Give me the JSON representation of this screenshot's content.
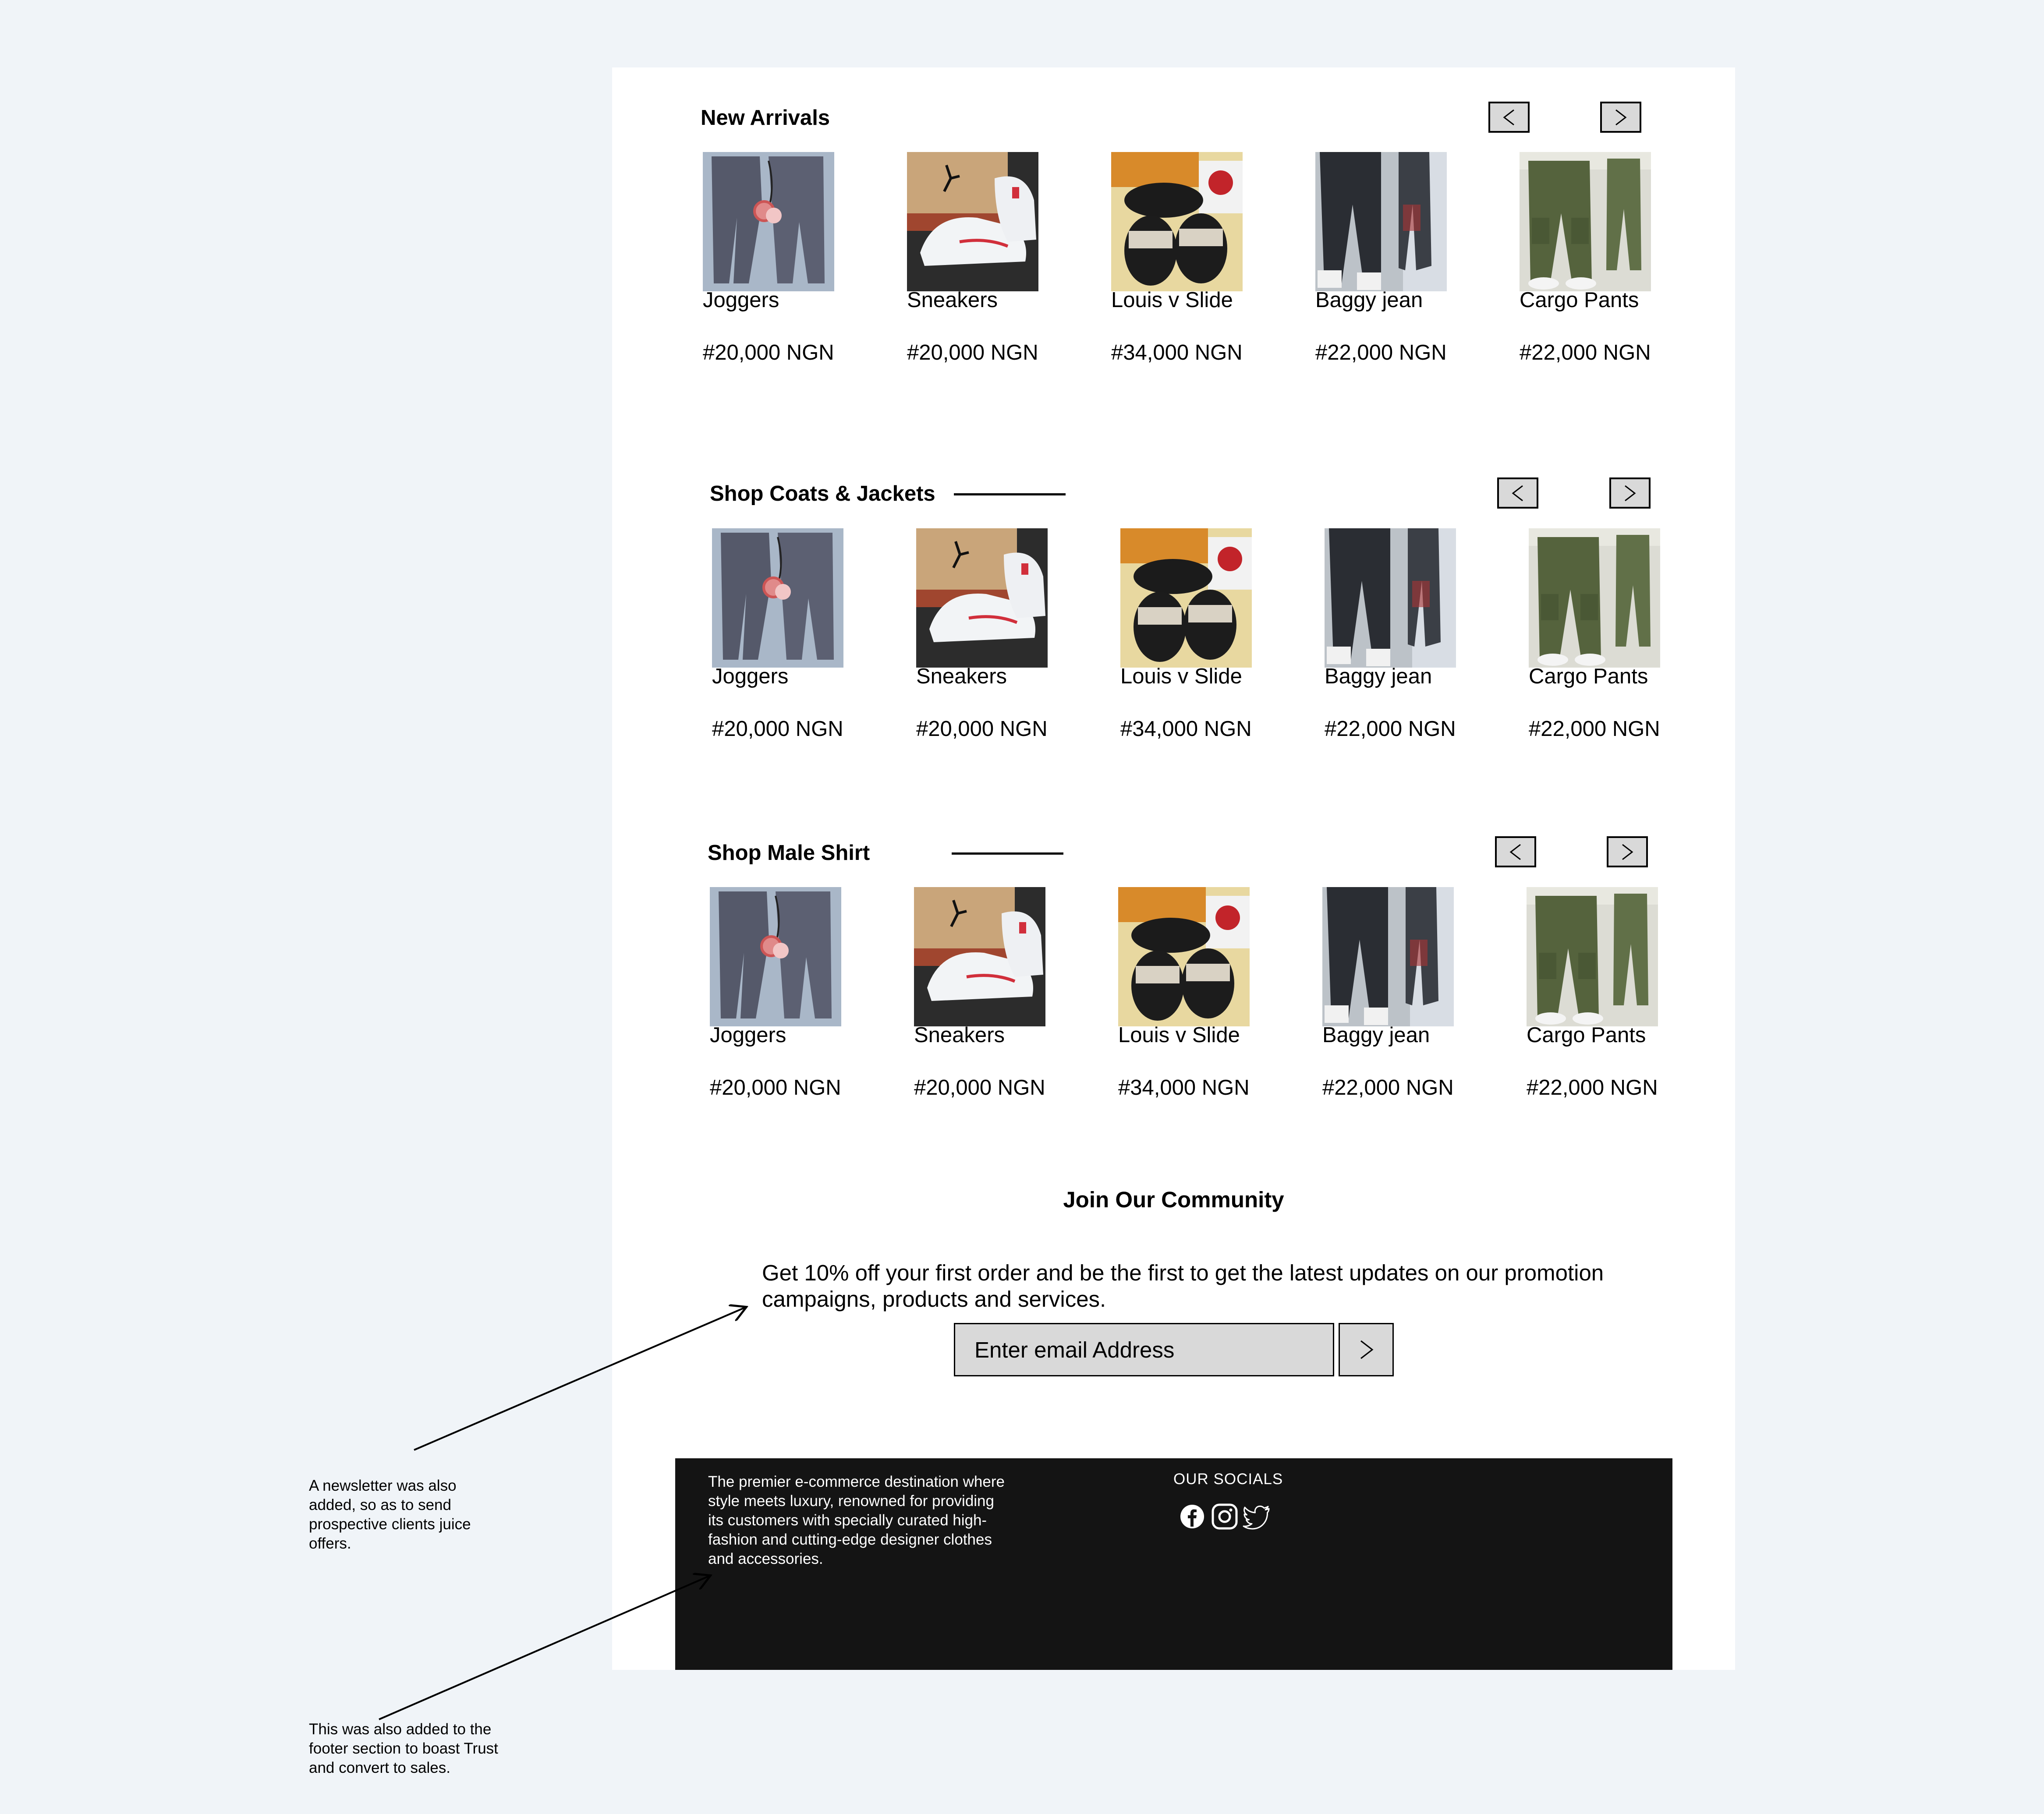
{
  "sections": [
    {
      "title": "New Arrivals",
      "prev_label": "<",
      "next_label": ">",
      "products": [
        {
          "name": "Joggers",
          "price": "#20,000 NGN",
          "image": "joggers"
        },
        {
          "name": "Sneakers",
          "price": "#20,000 NGN",
          "image": "sneakers"
        },
        {
          "name": "Louis v Slide",
          "price": "#34,000 NGN",
          "image": "slides"
        },
        {
          "name": "Baggy jean",
          "price": "#22,000 NGN",
          "image": "jeans"
        },
        {
          "name": "Cargo Pants",
          "price": "#22,000 NGN",
          "image": "cargo"
        }
      ]
    },
    {
      "title": "Shop Coats & Jackets",
      "prev_label": "<",
      "next_label": ">",
      "products": [
        {
          "name": "Joggers",
          "price": "#20,000 NGN",
          "image": "joggers"
        },
        {
          "name": "Sneakers",
          "price": "#20,000 NGN",
          "image": "sneakers"
        },
        {
          "name": "Louis v Slide",
          "price": "#34,000 NGN",
          "image": "slides"
        },
        {
          "name": "Baggy jean",
          "price": "#22,000 NGN",
          "image": "jeans"
        },
        {
          "name": "Cargo Pants",
          "price": "#22,000 NGN",
          "image": "cargo"
        }
      ]
    },
    {
      "title": "Shop Male Shirt",
      "prev_label": "<",
      "next_label": ">",
      "products": [
        {
          "name": "Joggers",
          "price": "#20,000 NGN",
          "image": "joggers"
        },
        {
          "name": "Sneakers",
          "price": "#20,000 NGN",
          "image": "sneakers"
        },
        {
          "name": "Louis v Slide",
          "price": "#34,000 NGN",
          "image": "slides"
        },
        {
          "name": "Baggy jean",
          "price": "#22,000 NGN",
          "image": "jeans"
        },
        {
          "name": "Cargo Pants",
          "price": "#22,000 NGN",
          "image": "cargo"
        }
      ]
    }
  ],
  "newsletter": {
    "title": "Join Our Community",
    "text": "Get 10% off your first order and be the first to get the latest updates on our promotion campaigns, products and services.",
    "email_placeholder": "Enter email Address",
    "submit_icon": "chevron-right-icon"
  },
  "footer": {
    "tagline": "The premier e-commerce destination where style meets luxury, renowned for providing its customers with specially curated high-fashion and cutting-edge designer clothes and accessories.",
    "socials_title": "OUR SOCIALS",
    "socials": [
      "facebook-icon",
      "instagram-icon",
      "twitter-icon"
    ]
  },
  "annotations": [
    "A newsletter was also added, so as to send prospective clients juice offers.",
    "This  was also added to the footer section to boast Trust and convert to sales."
  ]
}
